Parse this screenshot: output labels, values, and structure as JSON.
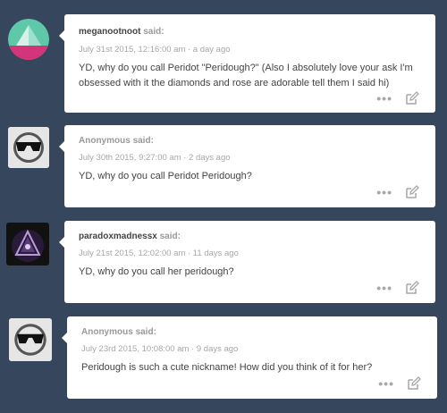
{
  "posts": [
    {
      "asker": "meganootnoot",
      "said": "said:",
      "date": "July 31st 2015, 12:16:00 am · a day ago",
      "question": "YD, why do you call Peridot \"Peridough?\" (Also I absolutely love your ask I'm obsessed with it the diamonds and rose are adorable tell them I said hi)",
      "more_label": "•••",
      "avatar_icon": "geometric-triangle-avatar"
    },
    {
      "asker": "Anonymous",
      "said": "said:",
      "date": "July 30th 2015, 9:27:00 am · 2 days ago",
      "question": "YD, why do you call Peridot Peridough?",
      "more_label": "•••",
      "avatar_icon": "anonymous-sunglasses-avatar"
    },
    {
      "asker": "paradoxmadnessx",
      "said": "said:",
      "date": "July 21st 2015, 12:02:00 am · 11 days ago",
      "question": "YD, why do you call her peridough?",
      "more_label": "•••",
      "avatar_icon": "dark-triangle-avatar"
    },
    {
      "asker": "Anonymous",
      "said": "said:",
      "date": "July 23rd 2015, 10:08:00 am · 9 days ago",
      "question": "Peridough is such a cute nickname! How did you think of it for her?",
      "more_label": "•••",
      "avatar_icon": "anonymous-sunglasses-avatar"
    }
  ],
  "colors": {
    "background": "#36465d",
    "card": "#ffffff",
    "muted_text": "#a7a7a7",
    "body_text": "#444444"
  }
}
